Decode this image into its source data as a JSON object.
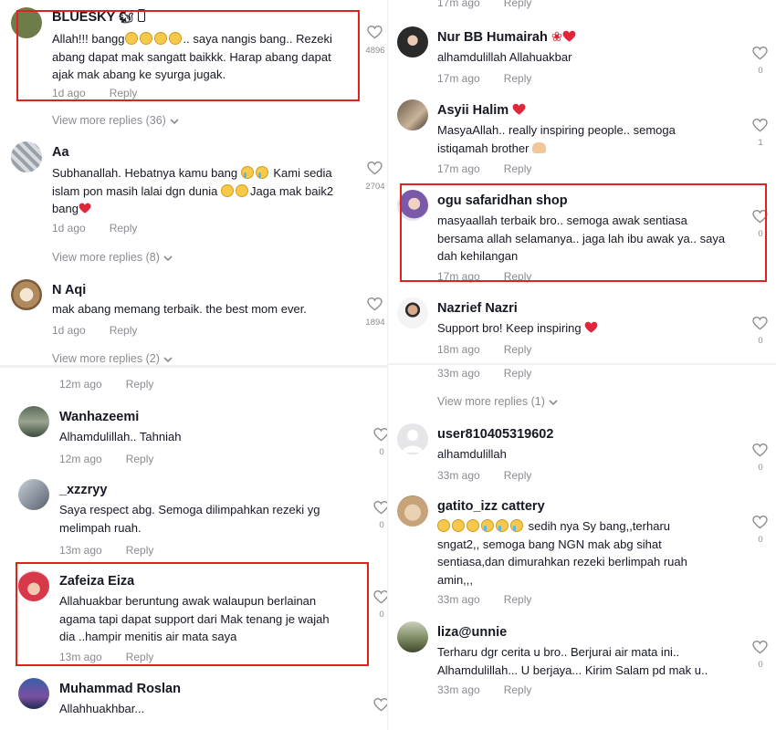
{
  "panel_top_left": {
    "comments": [
      {
        "username": "BLUESKY",
        "text": "Allah!!! bangg☹☹☹☹.. saya nangis bang.. Rezeki abang dapat mak sangatt baikkk. Harap abang dapat ajak mak abang ke syurga jugak.",
        "line1": "Allah!!! bangg",
        "line1b": ".. saya nangis bang.. Rezeki",
        "line2": "abang dapat mak sangatt baikkk. Harap abang dapat",
        "line3": "ajak mak abang ke syurga jugak.",
        "time": "1d ago",
        "reply": "Reply",
        "likes": "4896"
      },
      {
        "username": "Aa",
        "line1": "Subhanallah. Hebatnya kamu bang",
        "line1b": "Kami sedia",
        "line2": "islam pon masih lalai dgn dunia",
        "line2b": "Jaga mak baik2",
        "line3": "bang",
        "time": "1d ago",
        "reply": "Reply",
        "likes": "2704"
      },
      {
        "username": "N Aqi",
        "line1": "mak abang memang terbaik. the best mom ever.",
        "time": "1d ago",
        "reply": "Reply",
        "likes": "1894"
      }
    ],
    "view_more_1": "View more replies (36)",
    "view_more_2": "View more replies (8)",
    "view_more_3": "View more replies (2)"
  },
  "panel_bottom_left": {
    "top_time": "12m ago",
    "top_reply": "Reply",
    "comments": [
      {
        "username": "Wanhazeemi",
        "line1": "Alhamdulillah.. Tahniah",
        "time": "12m ago",
        "reply": "Reply",
        "likes": "0"
      },
      {
        "username": "_xzzryy",
        "line1": "Saya respect abg. Semoga dilimpahkan rezeki yg",
        "line2": "melimpah ruah.",
        "time": "13m ago",
        "reply": "Reply",
        "likes": "0"
      },
      {
        "username": "Zafeiza Eiza",
        "line1": "Allahuakbar beruntung awak walaupun berlainan",
        "line2": "agama tapi dapat support dari Mak tenang je wajah",
        "line3": "dia ..hampir menitis air mata saya",
        "time": "13m ago",
        "reply": "Reply",
        "likes": "0"
      },
      {
        "username": "Muhammad Roslan",
        "line1": "Allahhuakhbar...",
        "likes": ""
      }
    ]
  },
  "panel_right": {
    "top_time": "17m ago",
    "top_reply": "Reply",
    "comments": [
      {
        "username": "Nur BB Humairah",
        "line1": "alhamdulillah Allahuakbar",
        "time": "17m ago",
        "reply": "Reply",
        "likes": "0"
      },
      {
        "username": "Asyii Halim",
        "line1": "MasyaAllah.. really inspiring people.. semoga",
        "line2": "istiqamah brother",
        "time": "17m ago",
        "reply": "Reply",
        "likes": "1"
      },
      {
        "username": "ogu safaridhan shop",
        "line1": "masyaallah terbaik bro.. semoga awak sentiasa",
        "line2": "bersama allah selamanya.. jaga lah ibu awak ya.. saya",
        "line3": "dah kehilangan",
        "time": "17m ago",
        "reply": "Reply",
        "likes": "0"
      },
      {
        "username": "Nazrief Nazri",
        "line1": "Support bro! Keep inspiring",
        "time": "18m ago",
        "reply": "Reply",
        "likes": "0"
      },
      {
        "username": "user810405319602",
        "line1": "alhamdulillah",
        "time": "33m ago",
        "reply": "Reply",
        "likes": "0"
      },
      {
        "username": "gatito_izz cattery",
        "line1": "sedih nya Sy bang,,terharu",
        "line2": "sngat2,, semoga bang NGN mak abg sihat",
        "line3": "sentiasa,dan dimurahkan rezeki berlimpah ruah",
        "line4": "amin,,,",
        "time": "33m ago",
        "reply": "Reply",
        "likes": "0"
      },
      {
        "username": "liza@unnie",
        "line1": "Terharu dgr cerita u bro.. Berjurai air mata ini..",
        "line2": "Alhamdulillah... U berjaya... Kirim Salam pd mak u..",
        "time": "33m ago",
        "reply": "Reply",
        "likes": "0"
      }
    ],
    "mid_time": "33m ago",
    "mid_reply": "Reply",
    "view_more": "View more replies (1)"
  },
  "colors": {
    "highlight": "#e1211f",
    "muted": "#8a8b91",
    "text": "#161823",
    "heart_red": "#e0263b"
  }
}
